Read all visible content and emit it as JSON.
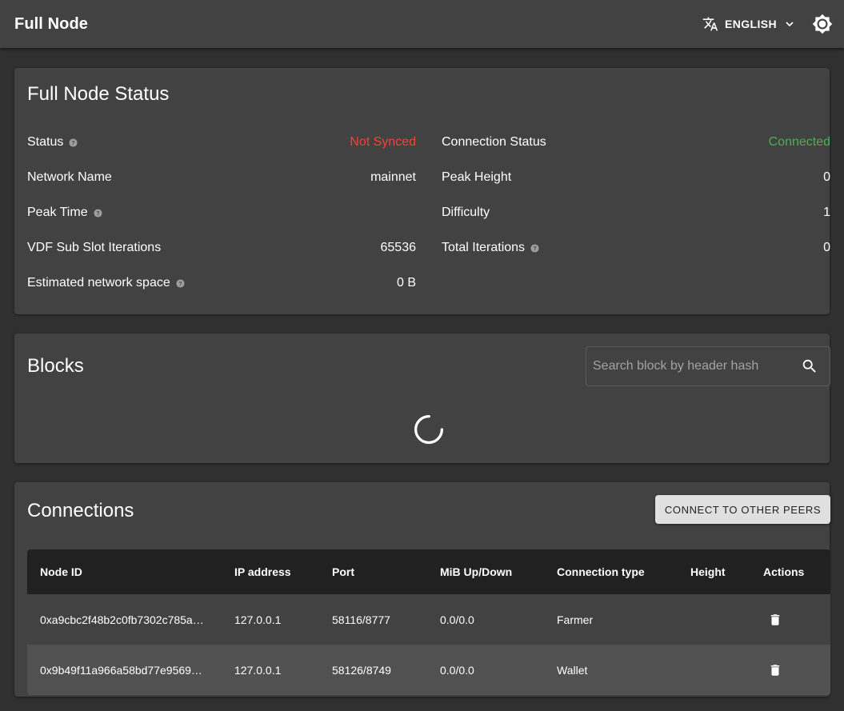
{
  "appbar": {
    "title": "Full Node",
    "language": "ENGLISH",
    "icons": {
      "translate": "translate-icon",
      "dropdown": "chevron-down-icon",
      "theme": "brightness-icon"
    }
  },
  "status": {
    "title": "Full Node Status",
    "left": [
      {
        "label": "Status",
        "value": "Not Synced",
        "help": true,
        "color": "#f44336"
      },
      {
        "label": "Network Name",
        "value": "mainnet",
        "help": false
      },
      {
        "label": "Peak Time",
        "value": "",
        "help": true
      },
      {
        "label": "VDF Sub Slot Iterations",
        "value": "65536",
        "help": false
      },
      {
        "label": "Estimated network space",
        "value": "0 B",
        "help": true
      }
    ],
    "right": [
      {
        "label": "Connection Status",
        "value": "Connected",
        "help": false,
        "color": "#4caf50"
      },
      {
        "label": "Peak Height",
        "value": "0",
        "help": false
      },
      {
        "label": "Difficulty",
        "value": "1",
        "help": false
      },
      {
        "label": "Total Iterations",
        "value": "0",
        "help": true
      }
    ]
  },
  "blocks": {
    "title": "Blocks",
    "search_placeholder": "Search block by header hash"
  },
  "connections": {
    "title": "Connections",
    "connect_button": "CONNECT TO OTHER PEERS",
    "columns": [
      "Node ID",
      "IP address",
      "Port",
      "MiB Up/Down",
      "Connection type",
      "Height",
      "Actions"
    ],
    "rows": [
      {
        "node_id": "0xa9cbc2f48b2c0fb7302c785a…",
        "ip": "127.0.0.1",
        "port": "58116/8777",
        "up_down": "0.0/0.0",
        "type": "Farmer",
        "height": ""
      },
      {
        "node_id": "0x9b49f11a966a58bd77e9569…",
        "ip": "127.0.0.1",
        "port": "58126/8749",
        "up_down": "0.0/0.0",
        "type": "Wallet",
        "height": ""
      }
    ]
  }
}
